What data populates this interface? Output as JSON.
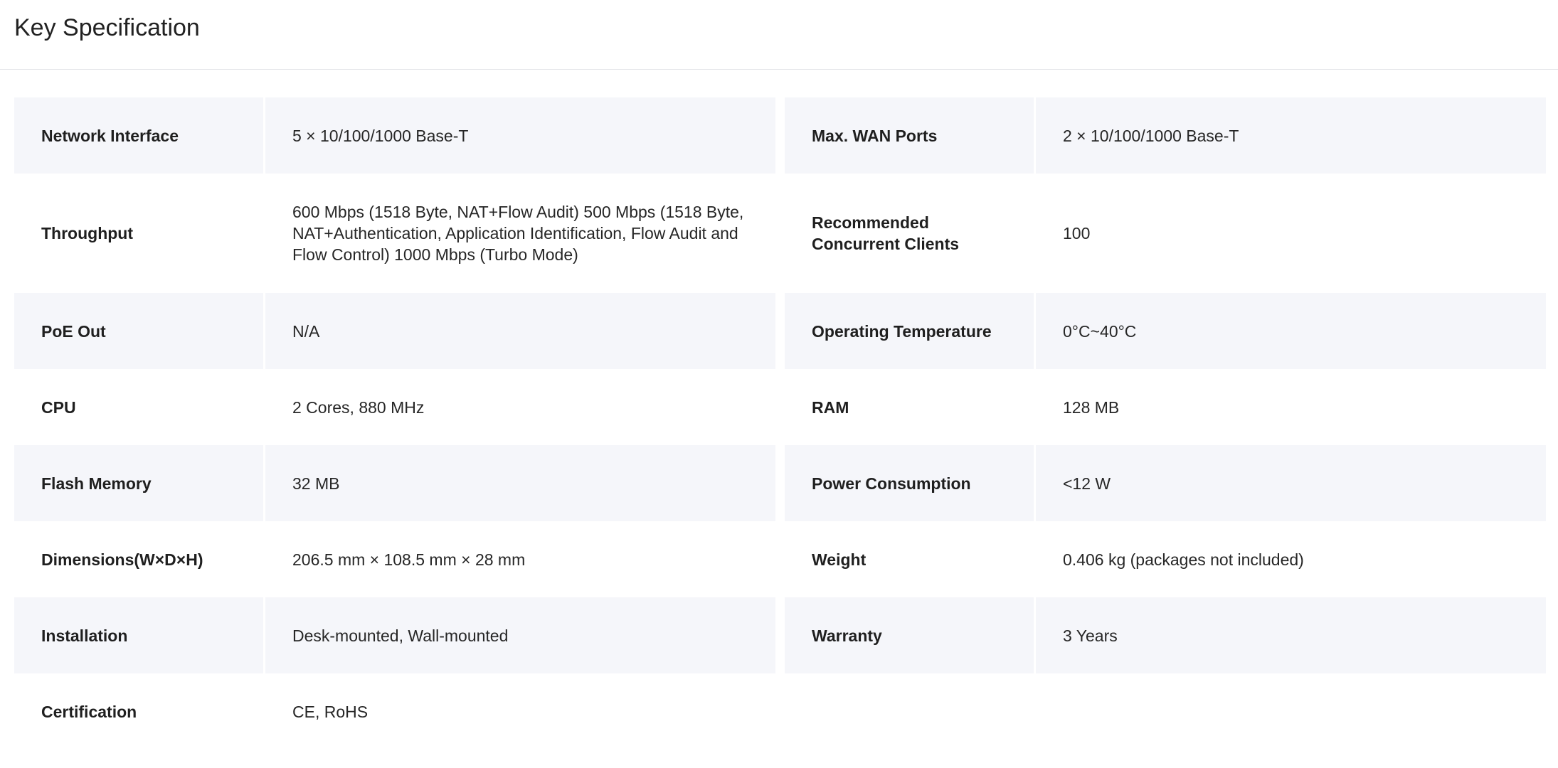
{
  "page": {
    "title": "Key Specification"
  },
  "specs": [
    {
      "left": {
        "label": "Network Interface",
        "value": "5 × 10/100/1000 Base-T"
      },
      "right": {
        "label": "Max. WAN Ports",
        "value": "2 × 10/100/1000 Base-T"
      }
    },
    {
      "left": {
        "label": "Throughput",
        "value": "600 Mbps (1518 Byte, NAT+Flow Audit) 500 Mbps (1518 Byte, NAT+Authentication, Application Identification, Flow Audit and Flow Control) 1000 Mbps (Turbo Mode)"
      },
      "right": {
        "label": "Recommended Concurrent Clients",
        "value": "100"
      }
    },
    {
      "left": {
        "label": "PoE Out",
        "value": "N/A"
      },
      "right": {
        "label": "Operating Temperature",
        "value": "0°C~40°C"
      }
    },
    {
      "left": {
        "label": "CPU",
        "value": "2 Cores, 880 MHz"
      },
      "right": {
        "label": "RAM",
        "value": "128 MB"
      }
    },
    {
      "left": {
        "label": "Flash Memory",
        "value": "32 MB"
      },
      "right": {
        "label": "Power Consumption",
        "value": "<12 W"
      }
    },
    {
      "left": {
        "label": "Dimensions(W×D×H)",
        "value": "206.5 mm × 108.5 mm × 28 mm"
      },
      "right": {
        "label": "Weight",
        "value": "0.406 kg (packages not included)"
      }
    },
    {
      "left": {
        "label": "Installation",
        "value": "Desk-mounted, Wall-mounted"
      },
      "right": {
        "label": "Warranty",
        "value": "3 Years"
      }
    },
    {
      "left": {
        "label": "Certification",
        "value": "CE, RoHS"
      },
      "right": {
        "label": "",
        "value": ""
      }
    }
  ]
}
